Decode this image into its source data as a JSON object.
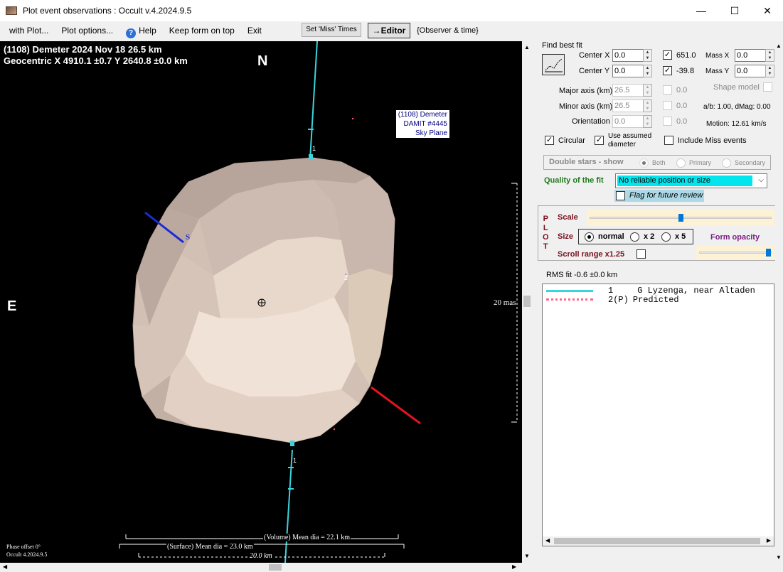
{
  "window": {
    "title": "Plot event observations : Occult v.4.2024.9.5",
    "minimize": "—",
    "maximize": "☐",
    "close": "✕"
  },
  "menu": {
    "with_plot": "with Plot...",
    "plot_options": "Plot options...",
    "help": "Help",
    "keep_on_top": "Keep form on top",
    "exit": "Exit",
    "set_miss_times": "Set 'Miss' Times",
    "editor": "→Editor",
    "observer_time": "{Observer & time}"
  },
  "plot": {
    "header_line1": "(1108) Demeter  2024 Nov 18   26.5 km",
    "header_line2": "Geocentric  X  4910.1 ±0.7  Y 2640.8 ±0.0 km",
    "north": "N",
    "east": "E",
    "legend": [
      "(1108) Demeter",
      "DAMIT #4445",
      "Sky Plane"
    ],
    "scale_label": "20 mas",
    "chord1_label_top": "1",
    "chord1_label_bottom": "1",
    "chord2_label": "2",
    "s_label": "S",
    "volume_dia": "(Volume) Mean dia = 22.1 km",
    "surface_dia": "(Surface) Mean dia = 23.0 km",
    "scale_km": "20.0 km",
    "phase_offset": "Phase offset 0°",
    "version": "Occult 4.2024.9.5"
  },
  "panel": {
    "find_best_fit": "Find best fit",
    "center_x_label": "Center X",
    "center_x": "0.0",
    "center_y_label": "Center Y",
    "center_y": "0.0",
    "fit_x": "651.0",
    "fit_y": "-39.8",
    "mass_x_label": "Mass X",
    "mass_x": "0.0",
    "mass_y_label": "Mass Y",
    "mass_y": "0.0",
    "major_axis_label": "Major axis (km)",
    "major_axis": "26.5",
    "major_axis_fit": "0.0",
    "minor_axis_label": "Minor axis (km)",
    "minor_axis": "26.5",
    "minor_axis_fit": "0.0",
    "orientation_label": "Orientation",
    "orientation": "0.0",
    "orientation_fit": "0.0",
    "shape_model": "Shape model",
    "ab_dmag": "a/b: 1.00, dMag: 0.00",
    "motion": "Motion: 12.61 km/s",
    "circular": "Circular",
    "use_assumed": "Use assumed",
    "diameter": "diameter",
    "include_miss": "Include Miss events",
    "double_stars": "Double stars - show",
    "both": "Both",
    "primary": "Primary",
    "secondary": "Secondary",
    "quality_label": "Quality of the fit",
    "quality_value": "No reliable position or size",
    "flag_review": "Flag for future review",
    "plot_letters": [
      "P",
      "L",
      "O",
      "T"
    ],
    "scale": "Scale",
    "size": "Size",
    "normal": "normal",
    "x2": "x 2",
    "x5": "x 5",
    "form_opacity": "Form opacity",
    "scroll_range": "Scroll range x1.25",
    "rms_fit": "RMS fit -0.6 ±0.0 km",
    "legend_rows": [
      {
        "num": "1",
        "text": "G Lyzenga, near Altaden"
      },
      {
        "num": "2(P)",
        "text": "Predicted"
      }
    ]
  },
  "colors": {
    "chord": "#39d5dc",
    "blue_axis": "#1a2bd8",
    "red_axis": "#e0141c",
    "asteroid": "#d9c5b8",
    "accent_green": "#1c7a1c",
    "highlight": "#00e5ee"
  }
}
